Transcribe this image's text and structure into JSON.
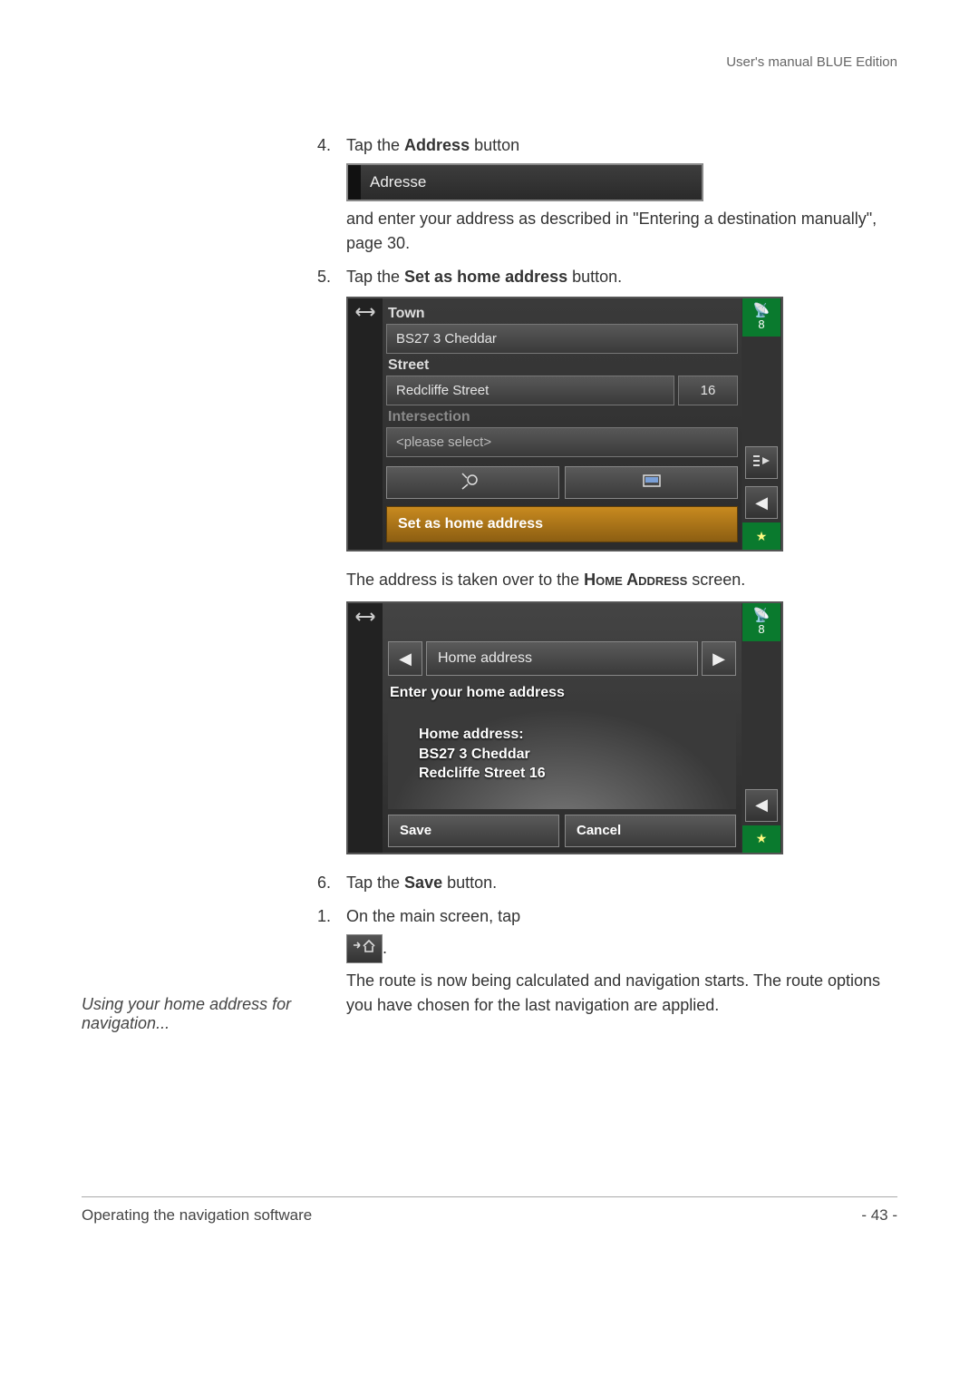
{
  "header": {
    "right": "User's manual BLUE Edition"
  },
  "steps": {
    "s4": {
      "num": "4.",
      "text_before": "Tap the ",
      "bold": "Address",
      "text_after": " button"
    },
    "s4_after1": "and enter your address as described in \"Entering a destination manually\", page 30.",
    "s5": {
      "num": "5.",
      "text_before": "Tap the ",
      "bold": "Set as home address",
      "text_after": " button."
    },
    "s5_after": {
      "before": "The address is taken over to the ",
      "smallcaps": "Home Address",
      "after": " screen."
    },
    "s6": {
      "num": "6.",
      "text_before": "Tap the ",
      "bold": "Save",
      "text_after": " button."
    },
    "s1b": {
      "num": "1.",
      "text": "On the main screen, tap"
    },
    "s1b_after": "The route is now being calculated and navigation starts. The route options you have chosen for the last navigation are applied."
  },
  "sidenote": "Using your home address for navigation...",
  "adresse_bar": {
    "label": "Adresse"
  },
  "shot2": {
    "sats": "8",
    "town_label": "Town",
    "town_value": "BS27 3 Cheddar",
    "street_label": "Street",
    "street_value": "Redcliffe Street",
    "house_no": "16",
    "intersection_label": "Intersection",
    "intersection_value": "<please select>",
    "set_home": "Set as home address"
  },
  "shot3": {
    "sats": "8",
    "title": "Home address",
    "panel_title": "Enter your home address",
    "addr_line1": "Home address:",
    "addr_line2": "BS27 3 Cheddar",
    "addr_line3": "Redcliffe Street 16",
    "save": "Save",
    "cancel": "Cancel"
  },
  "footer": {
    "left": "Operating the navigation software",
    "right": "- 43 -"
  }
}
